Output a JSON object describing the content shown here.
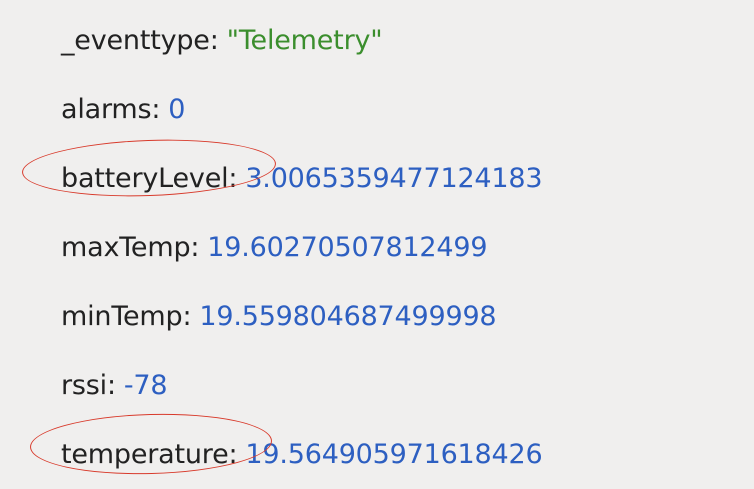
{
  "properties": [
    {
      "key": "_eventtype",
      "value": "\"Telemetry\"",
      "type": "string"
    },
    {
      "key": "alarms",
      "value": "0",
      "type": "number"
    },
    {
      "key": "batteryLevel",
      "value": "3.0065359477124183",
      "type": "number"
    },
    {
      "key": "maxTemp",
      "value": "19.60270507812499",
      "type": "number"
    },
    {
      "key": "minTemp",
      "value": "19.559804687499998",
      "type": "number"
    },
    {
      "key": "rssi",
      "value": "-78",
      "type": "number"
    },
    {
      "key": "temperature",
      "value": "19.564905971618426",
      "type": "number"
    }
  ],
  "separator": ":",
  "colors": {
    "background": "#f0efee",
    "key": "#222222",
    "number_value": "#2d5fc1",
    "string_value": "#3b8e2d",
    "annotation": "#d83a2b"
  }
}
